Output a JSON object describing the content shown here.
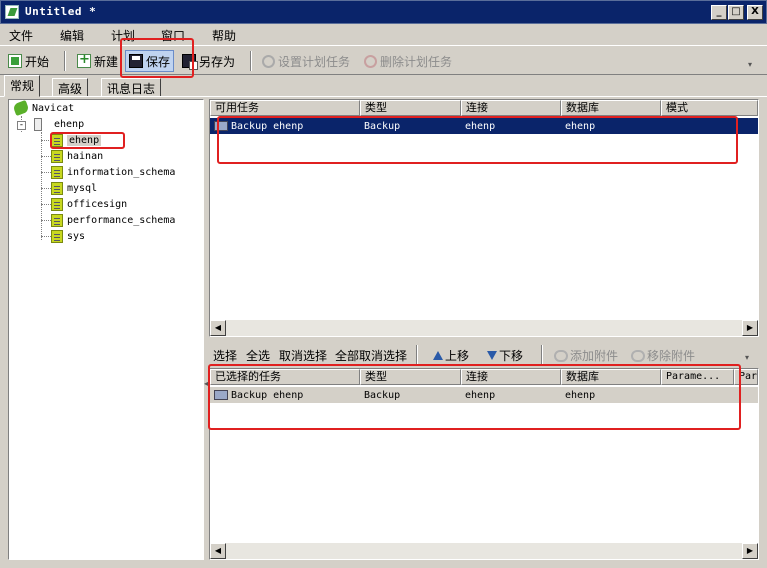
{
  "window": {
    "title": "Untitled *",
    "buttons": [
      "_",
      "□",
      "X"
    ]
  },
  "menu": [
    "文件",
    "编辑",
    "计划",
    "窗口",
    "帮助"
  ],
  "toolbar": {
    "start": "开始",
    "new": "新建",
    "save": "保存",
    "save_as": "另存为",
    "set_schedule": "设置计划任务",
    "delete_schedule": "删除计划任务"
  },
  "tabs": [
    "常规",
    "高级",
    "讯息日志"
  ],
  "tree": {
    "root": "Navicat",
    "connection": "ehenp",
    "databases": [
      "ehenp",
      "hainan",
      "information_schema",
      "mysql",
      "officesign",
      "performance_schema",
      "sys"
    ]
  },
  "available": {
    "columns": [
      "可用任务",
      "类型",
      "连接",
      "数据库",
      "模式"
    ],
    "rows": [
      {
        "task": "Backup ehenp",
        "type": "Backup",
        "conn": "ehenp",
        "db": "ehenp",
        "mode": ""
      }
    ]
  },
  "toolbar2": {
    "select": "选择",
    "select_all": "全选",
    "deselect": "取消选择",
    "deselect_all": "全部取消选择",
    "move_up": "上移",
    "move_down": "下移",
    "add_attachment": "添加附件",
    "remove_attachment": "移除附件"
  },
  "selected": {
    "columns": [
      "已选择的任务",
      "类型",
      "连接",
      "数据库",
      "Parame...",
      "Pars"
    ],
    "rows": [
      {
        "task": "Backup ehenp",
        "type": "Backup",
        "conn": "ehenp",
        "db": "ehenp",
        "params": "",
        "pars": ""
      }
    ]
  },
  "colors": {
    "title_bar": "#0a246a",
    "selection": "#0a246a",
    "annotation": "#e02020",
    "face": "#d4d0c8"
  },
  "icons": [
    "app-icon",
    "start-icon",
    "new-icon",
    "save-icon",
    "save-as-icon",
    "gear-icon",
    "delete-icon",
    "navicat-icon",
    "server-icon",
    "database-icon",
    "task-icon",
    "up-arrow-icon",
    "down-arrow-icon",
    "attachment-icon"
  ]
}
